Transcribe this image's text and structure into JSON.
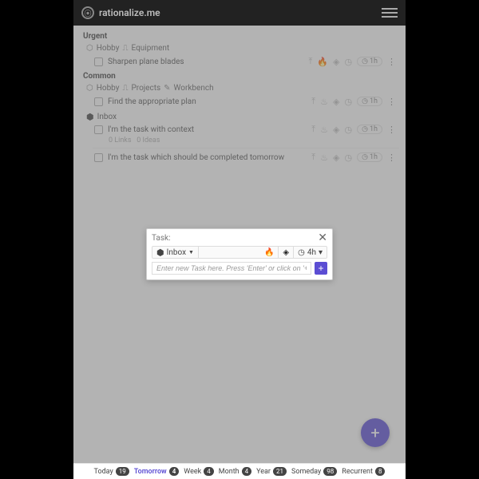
{
  "header": {
    "brand": "rationalize.me"
  },
  "sections": {
    "urgent": {
      "title": "Urgent",
      "breadcrumb": [
        "Hobby",
        "Equipment"
      ],
      "tasks": [
        {
          "text": "Sharpen plane blades",
          "fire": true,
          "time": "1h"
        }
      ]
    },
    "common": {
      "title": "Common",
      "breadcrumb": [
        "Hobby",
        "Projects",
        "Workbench"
      ],
      "tasks": [
        {
          "text": "Find the appropriate plan",
          "fire": false,
          "time": "1h"
        }
      ],
      "inbox": {
        "label": "Inbox",
        "tasks": [
          {
            "text": "I'm the task with context",
            "links": "0 Links",
            "ideas": "0 Ideas",
            "time": "1h"
          },
          {
            "text": "I'm the task which should be completed tomorrow",
            "time": "1h"
          }
        ]
      }
    }
  },
  "dialog": {
    "title": "Task:",
    "inbox_label": "Inbox",
    "time_label": "4h",
    "placeholder": "Enter new Task here. Press 'Enter' or click on '+' button.",
    "add": "+"
  },
  "footer": [
    {
      "label": "Today",
      "count": "19",
      "active": false
    },
    {
      "label": "Tomorrow",
      "count": "4",
      "active": true
    },
    {
      "label": "Week",
      "count": "4",
      "active": false
    },
    {
      "label": "Month",
      "count": "4",
      "active": false
    },
    {
      "label": "Year",
      "count": "21",
      "active": false
    },
    {
      "label": "Someday",
      "count": "98",
      "active": false
    },
    {
      "label": "Recurrent",
      "count": "8",
      "active": false
    }
  ],
  "fab": "+"
}
